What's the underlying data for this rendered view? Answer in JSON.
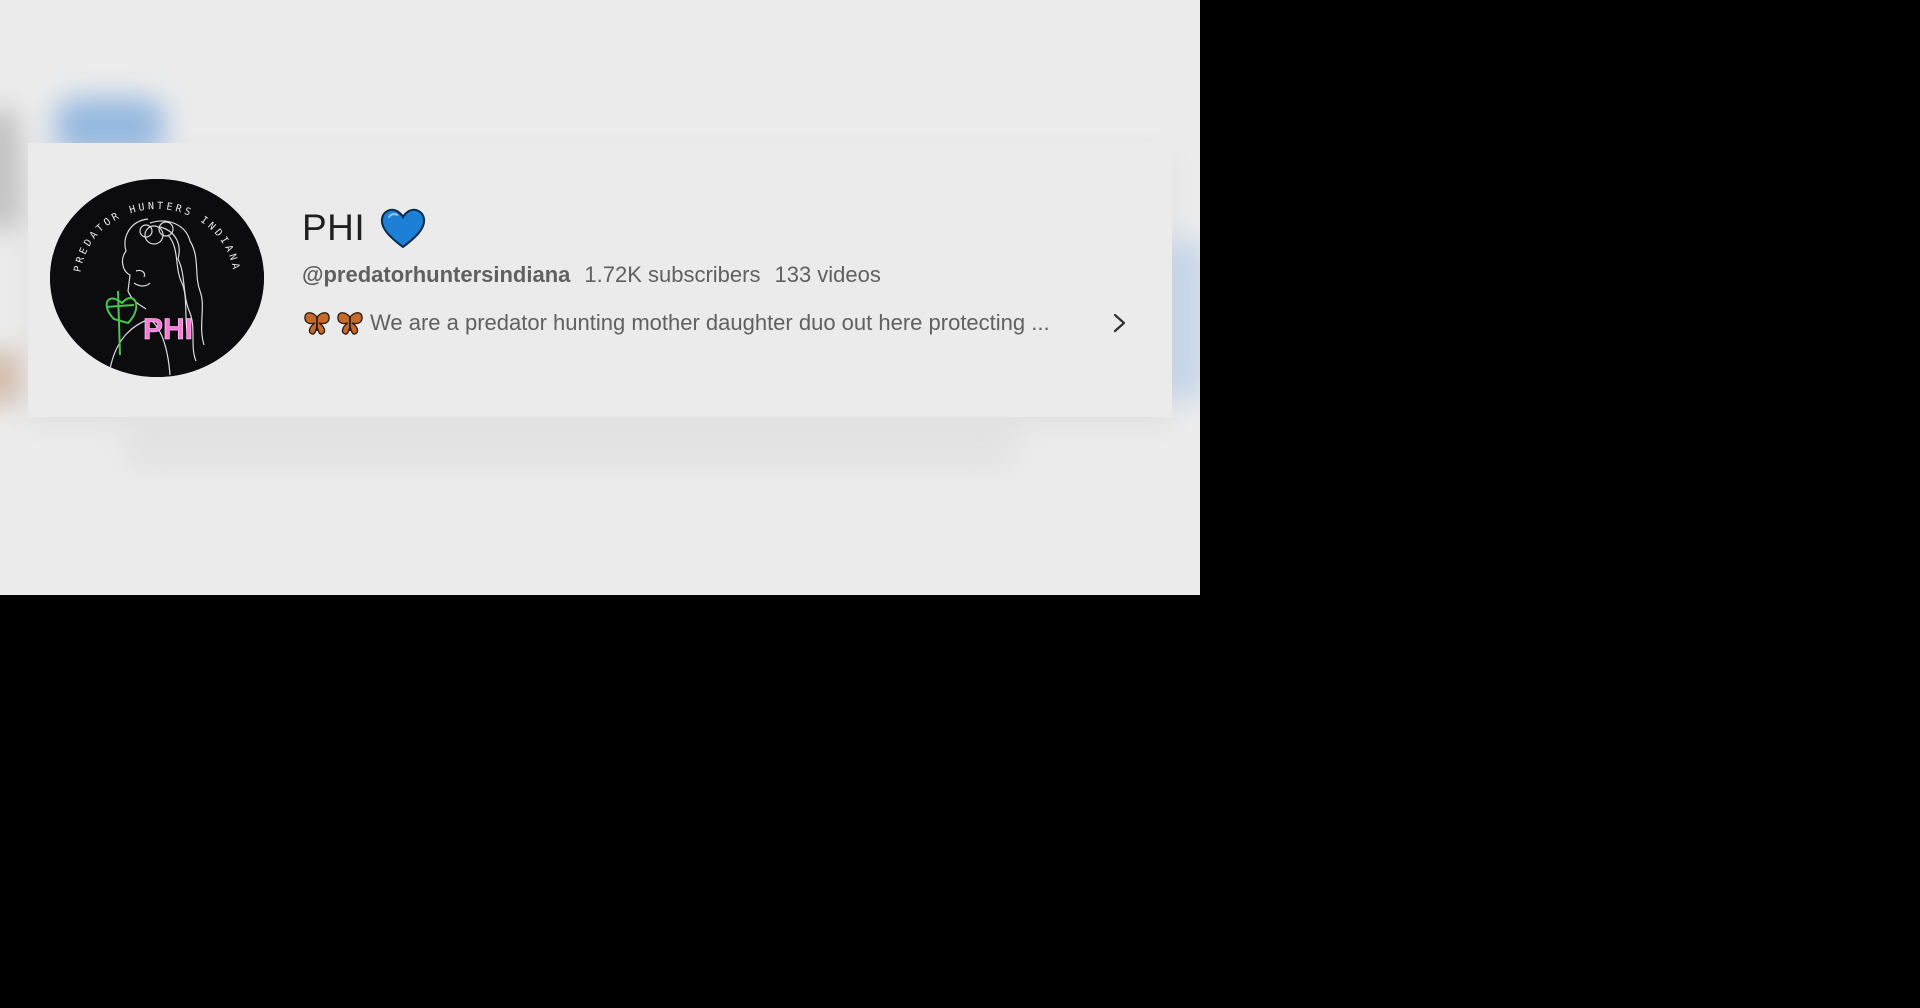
{
  "channel": {
    "name": "PHI",
    "handle": "@predatorhuntersindiana",
    "subscribers": "1.72K subscribers",
    "videos": "133 videos",
    "description": "We are a predator hunting mother daughter duo out here protecting ...",
    "avatar_text": "PHI",
    "avatar_ring_text": "PREDATOR HUNTERS INDIANA"
  },
  "icons": {
    "heart": "blue-heart-icon",
    "butterfly": "butterfly-icon",
    "chevron": "chevron-right-icon"
  },
  "colors": {
    "page_bg": "#ececec",
    "outer_bg": "#000000",
    "heart_blue": "#1e7fd6",
    "avatar_bg": "#0c0c0f",
    "avatar_pink": "#ff7ad9",
    "avatar_green": "#46c84a",
    "butterfly_orange": "#c56a2b"
  }
}
